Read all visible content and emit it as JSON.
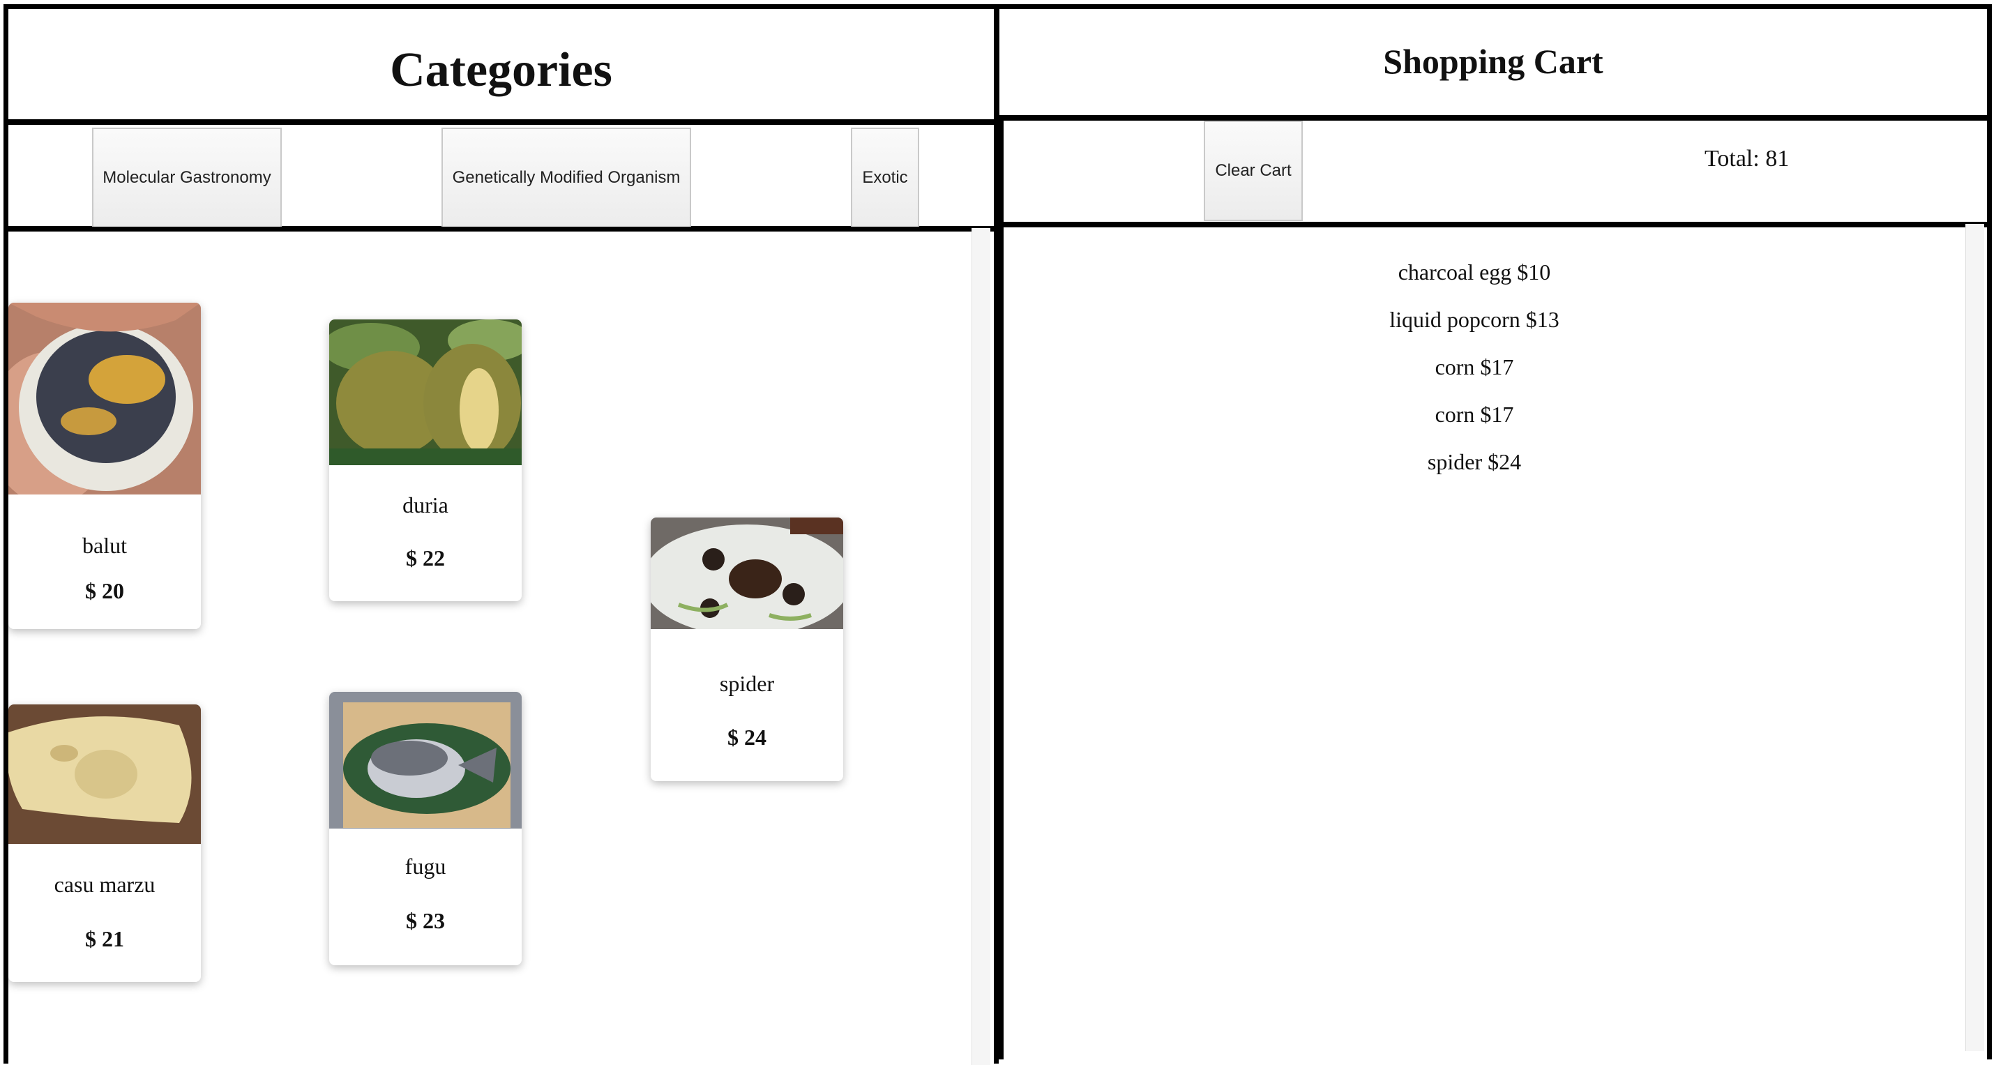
{
  "categories": {
    "title": "Categories",
    "buttons": [
      {
        "label": "Molecular Gastronomy"
      },
      {
        "label": "Genetically Modified Organism"
      },
      {
        "label": "Exotic"
      }
    ]
  },
  "products": [
    {
      "name": "balut",
      "price": "$ 20"
    },
    {
      "name": "duria",
      "price": "$ 22"
    },
    {
      "name": "spider",
      "price": "$ 24"
    },
    {
      "name": "casu marzu",
      "price": "$ 21"
    },
    {
      "name": "fugu",
      "price": "$ 23"
    }
  ],
  "cart": {
    "title": "Shopping Cart",
    "clear_label": "Clear Cart",
    "total_label": "Total: 81",
    "items": [
      "charcoal egg $10",
      "liquid popcorn $13",
      "corn $17",
      "corn $17",
      "spider $24"
    ]
  }
}
